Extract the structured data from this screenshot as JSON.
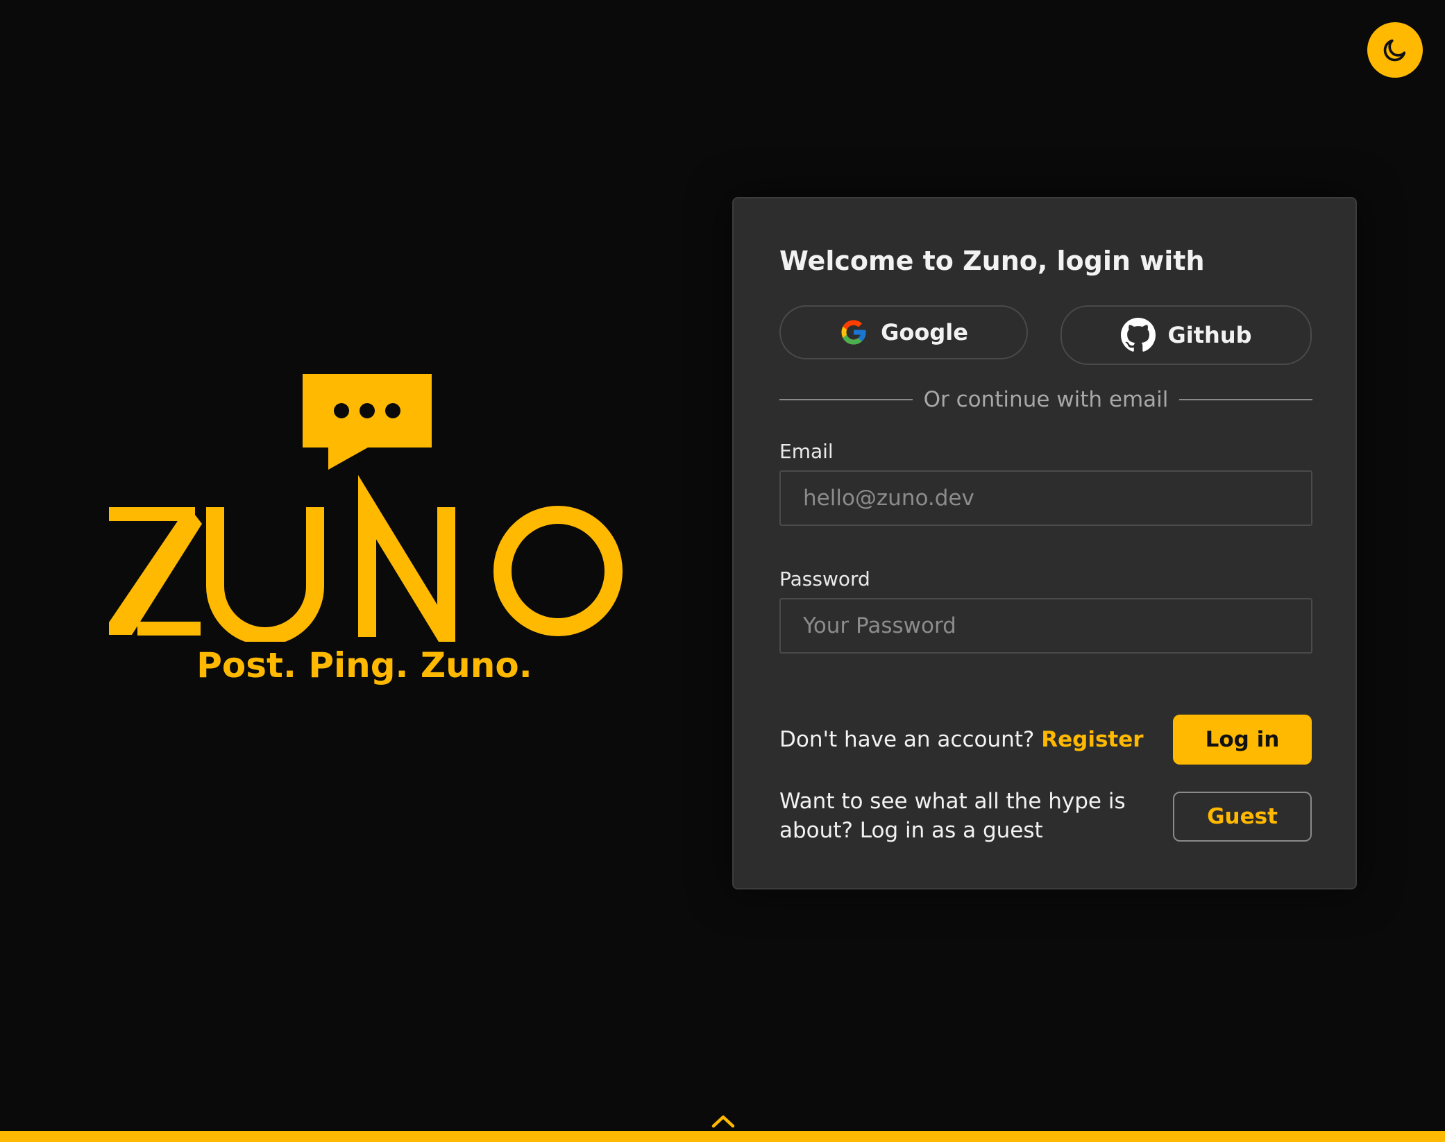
{
  "theme": {
    "accent": "#ffb900",
    "background": "#0a0a0a",
    "card": "#2d2d2d",
    "toggle_icon": "moon-icon"
  },
  "brand": {
    "wordmark": "ZUNO",
    "tagline": "Post. Ping. Zuno.",
    "logo_icon": "chat-bubble-icon"
  },
  "login": {
    "title": "Welcome to Zuno, login with",
    "oauth": {
      "google_label": "Google",
      "github_label": "Github"
    },
    "divider_text": "Or continue with email",
    "email": {
      "label": "Email",
      "placeholder": "hello@zuno.dev",
      "value": ""
    },
    "password": {
      "label": "Password",
      "placeholder": "Your Password",
      "value": ""
    },
    "register": {
      "prompt": "Don't have an account?",
      "link": "Register"
    },
    "login_button": "Log in",
    "guest": {
      "prompt": "Want to see what all the hype is about? Log in as a guest",
      "button": "Guest"
    }
  },
  "footer": {
    "icon": "chevron-up-icon"
  }
}
